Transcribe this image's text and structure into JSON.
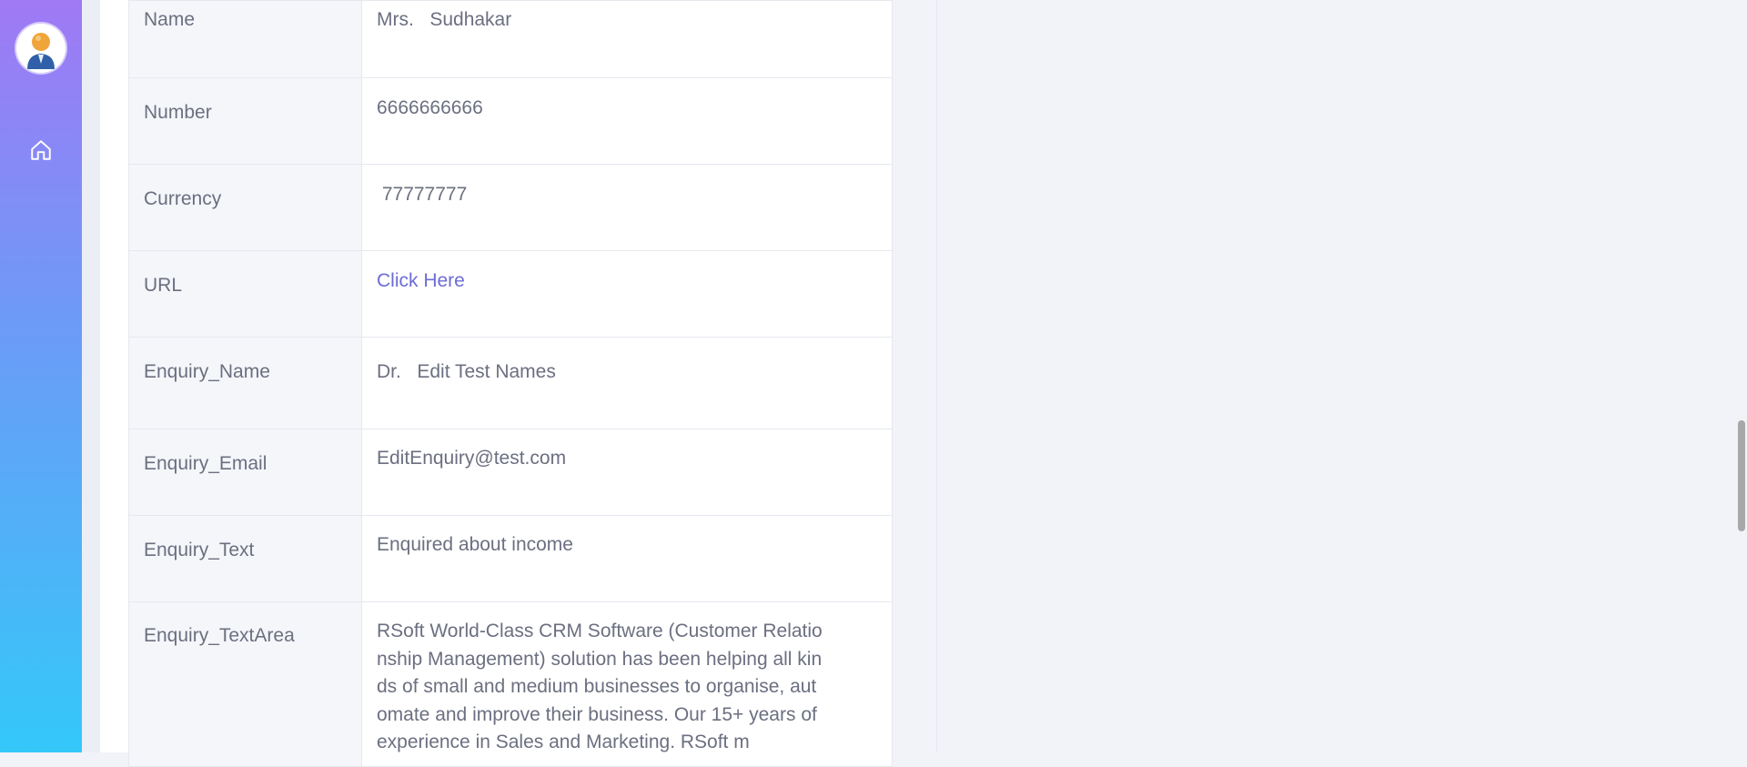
{
  "sidebar": {
    "avatar_icon": "user-avatar-icon",
    "home_icon": "home-icon"
  },
  "details": [
    {
      "label": "Name",
      "value": "Mrs.   Sudhakar"
    },
    {
      "label": "Number",
      "value": "6666666666"
    },
    {
      "label": "Currency",
      "value": " 77777777"
    },
    {
      "label": "URL",
      "value": "Click Here"
    },
    {
      "label": "Enquiry_Name",
      "value": "Dr.   Edit Test Names"
    },
    {
      "label": "Enquiry_Email",
      "value": "EditEnquiry@test.com"
    },
    {
      "label": "Enquiry_Text",
      "value": "Enquired about income"
    },
    {
      "label": "Enquiry_TextArea",
      "value": "RSoft World-Class CRM Software (Customer Relationship Management) solution has been helping all kinds of small and medium businesses to organise, automate and improve their business. Our 15+ years of experience in Sales and Marketing. RSoft m"
    }
  ],
  "colors": {
    "sidebar_top": "#a079f5",
    "sidebar_bottom": "#34c8f9",
    "link": "#6c6cd6",
    "text": "#6b6f80",
    "background": "#f2f3f8"
  }
}
